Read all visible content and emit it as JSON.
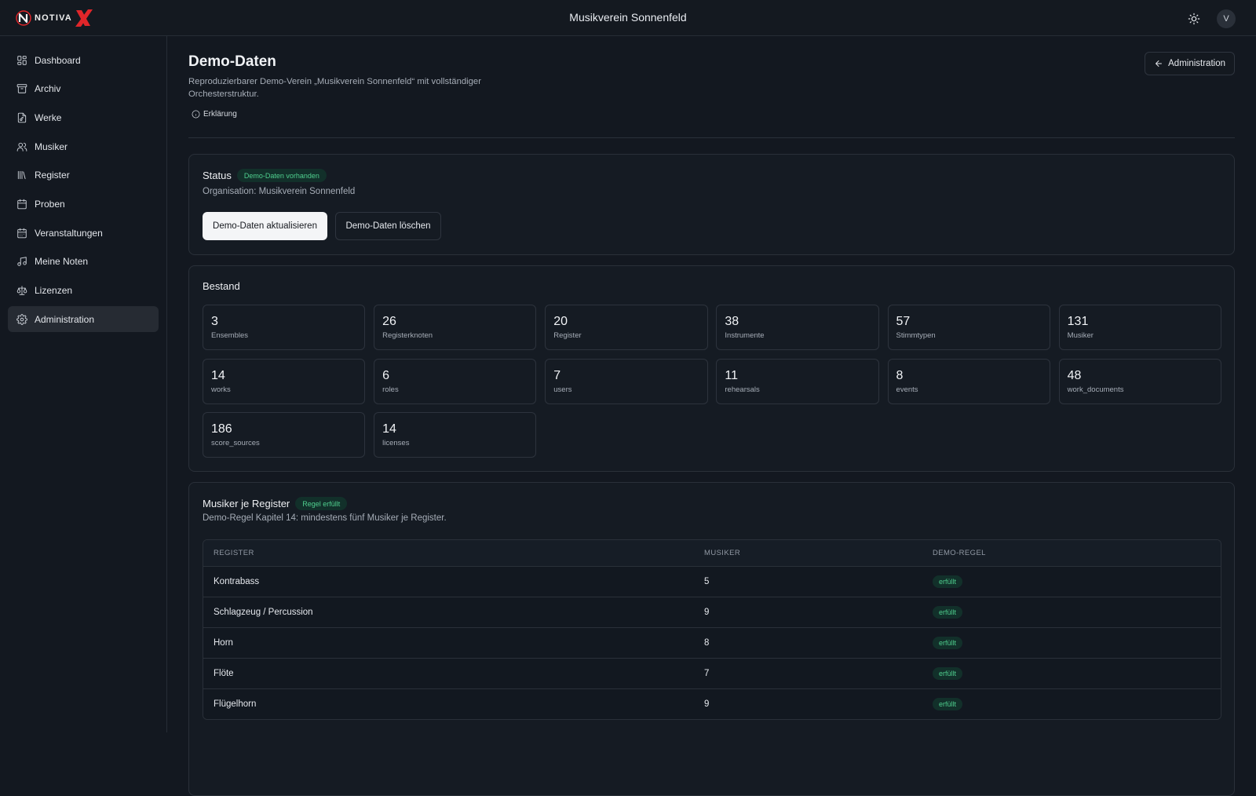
{
  "header": {
    "logo_text": "NOTIVA",
    "org_title": "Musikverein Sonnenfeld",
    "avatar_initial": "V"
  },
  "sidebar": {
    "items": [
      {
        "label": "Dashboard",
        "icon": "dashboard-icon"
      },
      {
        "label": "Archiv",
        "icon": "archive-icon"
      },
      {
        "label": "Werke",
        "icon": "music-file-icon"
      },
      {
        "label": "Musiker",
        "icon": "users-icon"
      },
      {
        "label": "Register",
        "icon": "library-icon"
      },
      {
        "label": "Proben",
        "icon": "calendar-icon"
      },
      {
        "label": "Veranstaltungen",
        "icon": "calendar-event-icon"
      },
      {
        "label": "Meine Noten",
        "icon": "music-note-icon"
      },
      {
        "label": "Lizenzen",
        "icon": "scale-icon"
      },
      {
        "label": "Administration",
        "icon": "gear-icon",
        "active": true
      }
    ]
  },
  "page": {
    "title": "Demo-Daten",
    "description": "Reproduzierbarer Demo-Verein „Musikverein Sonnenfeld“ mit vollständiger Orchesterstruktur.",
    "explain_label": "Erklärung",
    "back_button_label": "Administration"
  },
  "status": {
    "title": "Status",
    "badge": "Demo-Daten vorhanden",
    "org_line": "Organisation: Musikverein Sonnenfeld",
    "refresh_label": "Demo-Daten aktualisieren",
    "delete_label": "Demo-Daten löschen"
  },
  "bestand": {
    "title": "Bestand",
    "stats": [
      {
        "value": "3",
        "label": "Ensembles"
      },
      {
        "value": "26",
        "label": "Registerknoten"
      },
      {
        "value": "20",
        "label": "Register"
      },
      {
        "value": "38",
        "label": "Instrumente"
      },
      {
        "value": "57",
        "label": "Stimmtypen"
      },
      {
        "value": "131",
        "label": "Musiker"
      },
      {
        "value": "14",
        "label": "works"
      },
      {
        "value": "6",
        "label": "roles"
      },
      {
        "value": "7",
        "label": "users"
      },
      {
        "value": "11",
        "label": "rehearsals"
      },
      {
        "value": "8",
        "label": "events"
      },
      {
        "value": "48",
        "label": "work_documents"
      },
      {
        "value": "186",
        "label": "score_sources"
      },
      {
        "value": "14",
        "label": "licenses"
      }
    ]
  },
  "musiker_register": {
    "title": "Musiker je Register",
    "badge": "Regel erfüllt",
    "description": "Demo-Regel Kapitel 14: mindestens fünf Musiker je Register.",
    "columns": [
      "REGISTER",
      "MUSIKER",
      "DEMO-REGEL"
    ],
    "rows": [
      {
        "register": "Kontrabass",
        "musiker": "5",
        "regel": "erfüllt"
      },
      {
        "register": "Schlagzeug / Percussion",
        "musiker": "9",
        "regel": "erfüllt"
      },
      {
        "register": "Horn",
        "musiker": "8",
        "regel": "erfüllt"
      },
      {
        "register": "Flöte",
        "musiker": "7",
        "regel": "erfüllt"
      },
      {
        "register": "Flügelhorn",
        "musiker": "9",
        "regel": "erfüllt"
      }
    ]
  },
  "colors": {
    "background": "#131820",
    "card": "#151b23",
    "success_text": "#4fcf8e",
    "success_bg": "#12302a",
    "logo_red": "#e0262a"
  }
}
